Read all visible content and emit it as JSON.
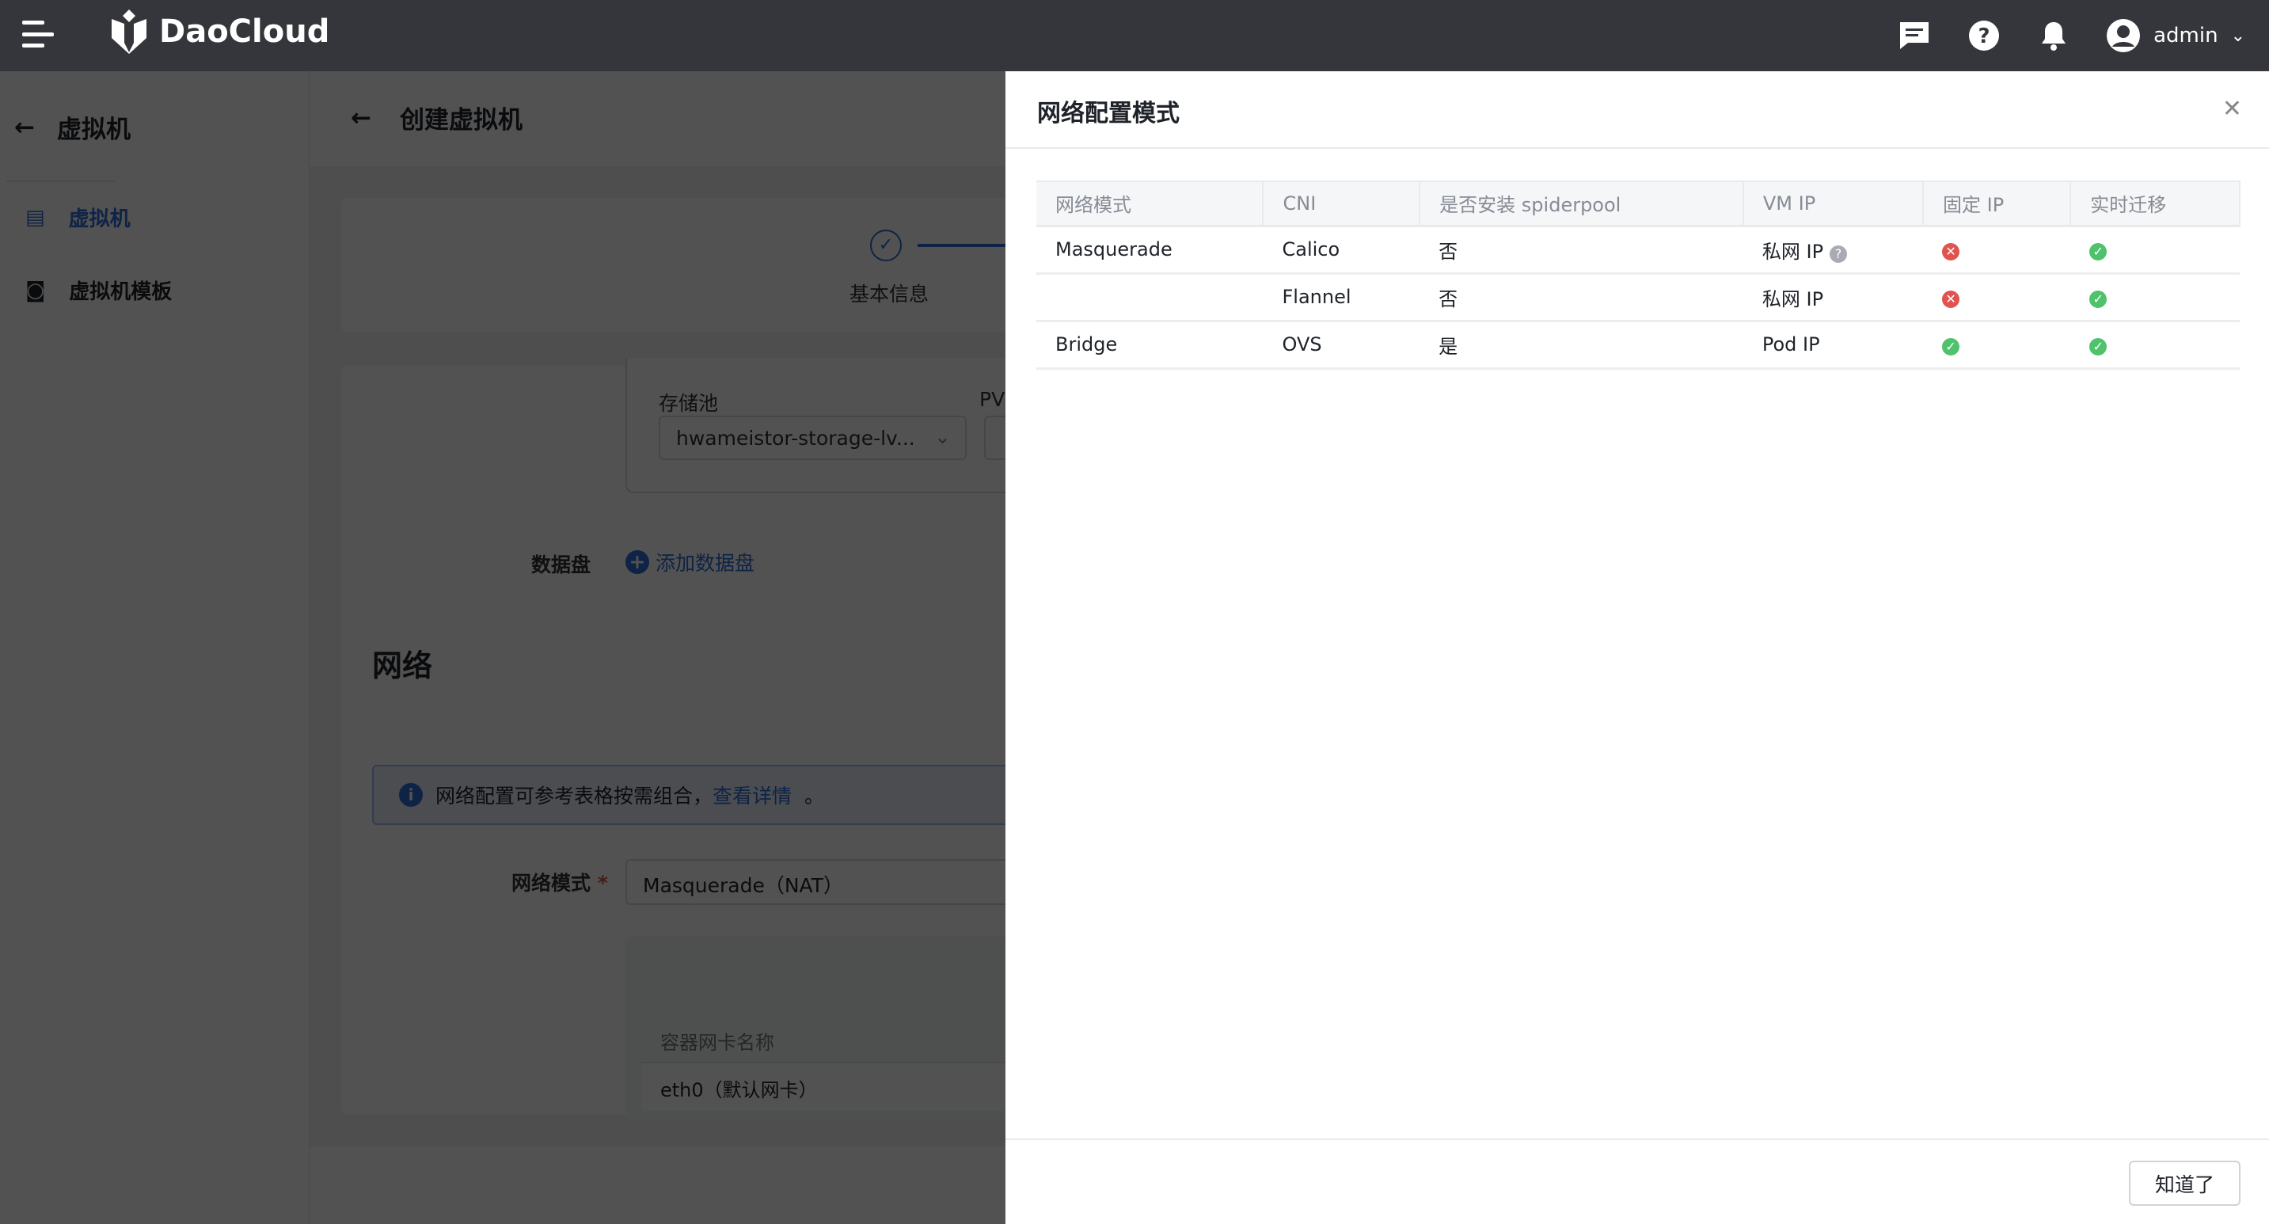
{
  "header": {
    "brand": "DaoCloud",
    "user": "admin"
  },
  "sidebar": {
    "title": "虚拟机",
    "items": [
      {
        "label": "虚拟机"
      },
      {
        "label": "虚拟机模板"
      }
    ]
  },
  "main": {
    "title": "创建虚拟机",
    "step1": "基本信息",
    "storage_pool_label": "存储池",
    "storage_pool_value": "hwameistor-storage-lv...",
    "pv_label": "PV",
    "data_disk_label": "数据盘",
    "add_data_disk": "添加数据盘",
    "network_heading": "网络",
    "info_text": "网络配置可参考表格按需组合，",
    "info_link": "查看详情",
    "info_end": "。",
    "network_mode_label": "网络模式",
    "network_mode_value": "Masquerade（NAT）",
    "nic_col": "容器网卡名称",
    "nic_value": "eth0（默认网卡）"
  },
  "drawer": {
    "title": "网络配置模式",
    "ok": "知道了",
    "columns": [
      "网络模式",
      "CNI",
      "是否安装 spiderpool",
      "VM IP",
      "固定 IP",
      "实时迁移"
    ],
    "rows": [
      {
        "mode": "Masquerade",
        "cni": "Calico",
        "spiderpool": "否",
        "vmip": "私网 IP",
        "fixed_ip": false,
        "live_migration": true
      },
      {
        "mode": "",
        "cni": "Flannel",
        "spiderpool": "否",
        "vmip": "私网 IP",
        "fixed_ip": false,
        "live_migration": true
      },
      {
        "mode": "Bridge",
        "cni": "OVS",
        "spiderpool": "是",
        "vmip": "Pod IP",
        "fixed_ip": true,
        "live_migration": true
      }
    ]
  },
  "colors": {
    "accent": "#2b6cd8",
    "ok": "#4fc26c",
    "error": "#e0534f",
    "topbar": "#35363b"
  }
}
